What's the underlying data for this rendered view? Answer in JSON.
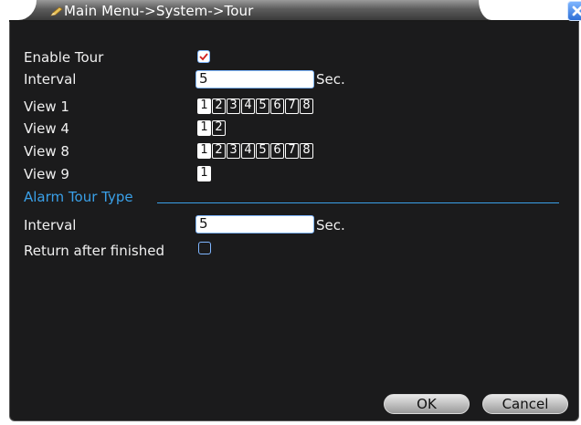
{
  "window": {
    "title": "Main Menu->System->Tour"
  },
  "form": {
    "enable_tour_label": "Enable Tour",
    "enable_tour_checked": true,
    "interval_label": "Interval",
    "interval_value": "5",
    "interval_unit": "Sec.",
    "views": [
      {
        "label": "View 1",
        "channels": [
          "1",
          "2",
          "3",
          "4",
          "5",
          "6",
          "7",
          "8"
        ],
        "selected": [
          "1"
        ]
      },
      {
        "label": "View 4",
        "channels": [
          "1",
          "2"
        ],
        "selected": [
          "1"
        ]
      },
      {
        "label": "View 8",
        "channels": [
          "1",
          "2",
          "3",
          "4",
          "5",
          "6",
          "7",
          "8"
        ],
        "selected": [
          "1"
        ]
      },
      {
        "label": "View 9",
        "channels": [
          "1"
        ],
        "selected": [
          "1"
        ]
      }
    ],
    "alarm_section_label": "Alarm Tour Type",
    "alarm_interval_label": "Interval",
    "alarm_interval_value": "5",
    "alarm_interval_unit": "Sec.",
    "return_after_label": "Return after finished",
    "return_after_checked": false
  },
  "buttons": {
    "ok": "OK",
    "cancel": "Cancel"
  },
  "colors": {
    "panel_bg": "#1b1b1c",
    "accent_blue": "#3aa0e8",
    "checkbox_border": "#7fb6ff",
    "check_mark": "#d02020"
  },
  "icons": {
    "title": "pencil-icon",
    "close": "close-icon"
  }
}
